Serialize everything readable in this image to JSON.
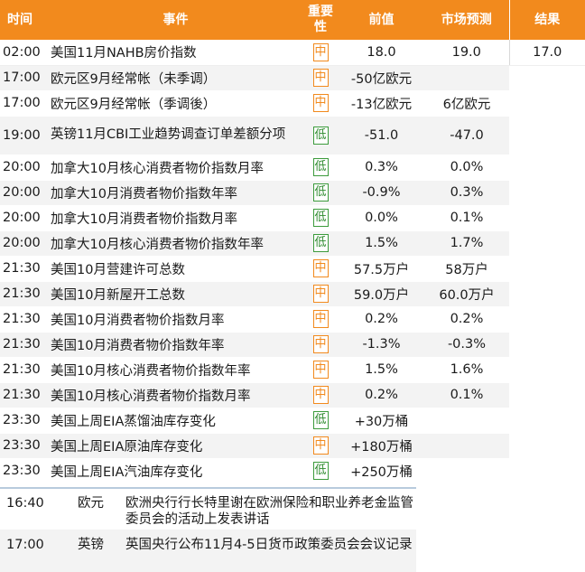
{
  "headers": {
    "time": "时间",
    "event": "事件",
    "importance": "重要\n性",
    "previous": "前值",
    "forecast": "市场预测",
    "result": "结果"
  },
  "colors": {
    "header_bg": "#f28a1d",
    "badge_mid": "#f28a1d",
    "badge_low": "#2e8b2e",
    "row_alt": "#f3f3f3"
  },
  "rows": [
    {
      "time": "02:00",
      "event": "美国11月NAHB房价指数",
      "importance": "中",
      "previous": "18.0",
      "forecast": "19.0",
      "result": "17.0"
    },
    {
      "time": "17:00",
      "event": "欧元区9月经常帐（未季调）",
      "importance": "中",
      "previous": "-50亿欧元",
      "forecast": "",
      "result": ""
    },
    {
      "time": "17:00",
      "event": "欧元区9月经常帐（季调後）",
      "importance": "中",
      "previous": "-13亿欧元",
      "forecast": "6亿欧元",
      "result": ""
    },
    {
      "time": "19:00",
      "event": "英镑11月CBI工业趋势调查订单差额分项",
      "importance": "低",
      "previous": "-51.0",
      "forecast": "-47.0",
      "result": ""
    },
    {
      "time": "20:00",
      "event": "加拿大10月核心消费者物价指数月率",
      "importance": "低",
      "previous": "0.3%",
      "forecast": "0.0%",
      "result": ""
    },
    {
      "time": "20:00",
      "event": "加拿大10月消费者物价指数年率",
      "importance": "低",
      "previous": "-0.9%",
      "forecast": "0.3%",
      "result": ""
    },
    {
      "time": "20:00",
      "event": "加拿大10月消费者物价指数月率",
      "importance": "低",
      "previous": "0.0%",
      "forecast": "0.1%",
      "result": ""
    },
    {
      "time": "20:00",
      "event": "加拿大10月核心消费者物价指数年率",
      "importance": "低",
      "previous": "1.5%",
      "forecast": "1.7%",
      "result": ""
    },
    {
      "time": "21:30",
      "event": "美国10月营建许可总数",
      "importance": "中",
      "previous": "57.5万户",
      "forecast": "58万户",
      "result": ""
    },
    {
      "time": "21:30",
      "event": "美国10月新屋开工总数",
      "importance": "中",
      "previous": "59.0万户",
      "forecast": "60.0万户",
      "result": ""
    },
    {
      "time": "21:30",
      "event": "美国10月消费者物价指数月率",
      "importance": "中",
      "previous": "0.2%",
      "forecast": "0.2%",
      "result": ""
    },
    {
      "time": "21:30",
      "event": "美国10月消费者物价指数年率",
      "importance": "中",
      "previous": "-1.3%",
      "forecast": "-0.3%",
      "result": ""
    },
    {
      "time": "21:30",
      "event": "美国10月核心消费者物价指数年率",
      "importance": "中",
      "previous": "1.5%",
      "forecast": "1.6%",
      "result": ""
    },
    {
      "time": "21:30",
      "event": "美国10月核心消费者物价指数月率",
      "importance": "中",
      "previous": "0.2%",
      "forecast": "0.1%",
      "result": ""
    },
    {
      "time": "23:30",
      "event": "美国上周EIA蒸馏油库存变化",
      "importance": "低",
      "previous": "+30万桶",
      "forecast": "",
      "result": ""
    },
    {
      "time": "23:30",
      "event": "美国上周EIA原油库存变化",
      "importance": "中",
      "previous": "+180万桶",
      "forecast": "",
      "result": ""
    },
    {
      "time": "23:30",
      "event": "美国上周EIA汽油库存变化",
      "importance": "低",
      "previous": "+250万桶",
      "forecast": "",
      "result": ""
    }
  ],
  "events": [
    {
      "time": "16:40",
      "country": "欧元",
      "text": "欧洲央行行长特里谢在欧洲保险和职业养老金监管委员会的活动上发表讲话"
    },
    {
      "time": "17:00",
      "country": "英镑",
      "text": "英国央行公布11月4-5日货币政策委员会会议记录"
    }
  ]
}
